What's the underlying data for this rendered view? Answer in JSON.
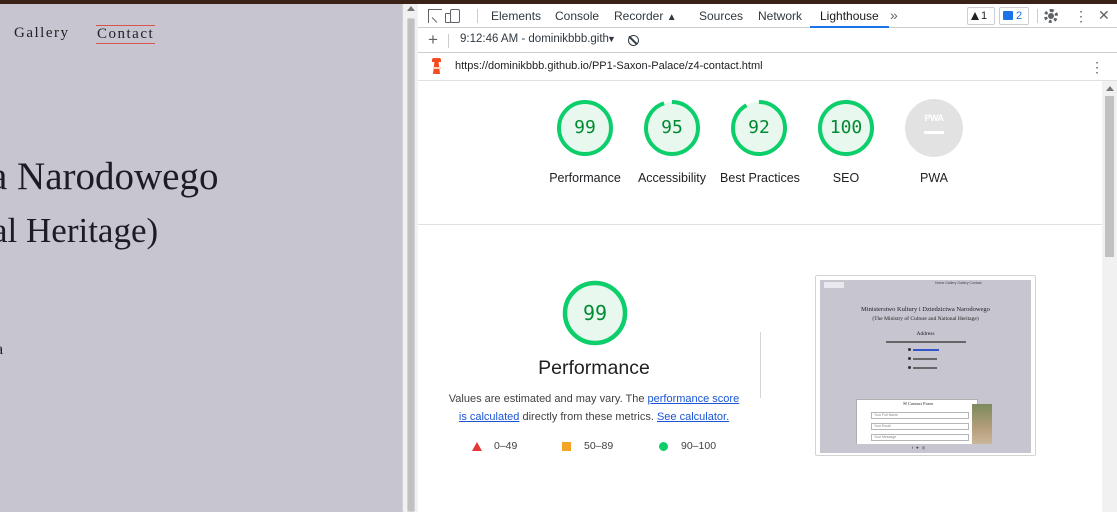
{
  "site": {
    "nav": {
      "gallery": "Gallery",
      "contact": "Contact"
    },
    "hero_line1": "a Narodowego",
    "hero_line2": "al Heritage)",
    "hero_line3": "a"
  },
  "devtools": {
    "tabs": [
      "Elements",
      "Console",
      "Recorder",
      "Sources",
      "Network",
      "Lighthouse"
    ],
    "active_tab": "Lighthouse",
    "more_tabs": "»",
    "warnings_count": "1",
    "messages_count": "2",
    "report_selector": "9:12:46 AM - dominikbbb.gith",
    "url": "https://dominikbbb.github.io/PP1-Saxon-Palace/z4-contact.html"
  },
  "scores": [
    {
      "label": "Performance",
      "value": "99"
    },
    {
      "label": "Accessibility",
      "value": "95"
    },
    {
      "label": "Best Practices",
      "value": "92"
    },
    {
      "label": "SEO",
      "value": "100"
    }
  ],
  "pwa": {
    "label": "PWA",
    "badge": "PWA"
  },
  "performance": {
    "score": "99",
    "title": "Performance",
    "desc_1": "Values are estimated and may vary. The ",
    "desc_link1": "performance score is calculated",
    "desc_2": " directly from these metrics. ",
    "desc_link2": "See calculator."
  },
  "legend": {
    "low": "0–49",
    "mid": "50–89",
    "high": "90–100"
  },
  "thumbnail": {
    "nav": "Home  Gallery  Gallery  Contact",
    "title1": "Ministerstwo Kultury i Dziedzictwa Narodowego",
    "title2": "(The Ministry of Culture and National Heritage)",
    "address_heading": "Address",
    "form_title": "✉ Contact Form",
    "field1": "Your Full Name",
    "field2": "Your Email",
    "field3": "Your Message",
    "footer_icons": "f ♥ ◎"
  },
  "colors": {
    "pass": "#0cce6b",
    "pass_text": "#008a32",
    "pass_fill": "#e8f8ee",
    "link": "#1a55d6",
    "active_tab_underline": "#1a73e8"
  }
}
